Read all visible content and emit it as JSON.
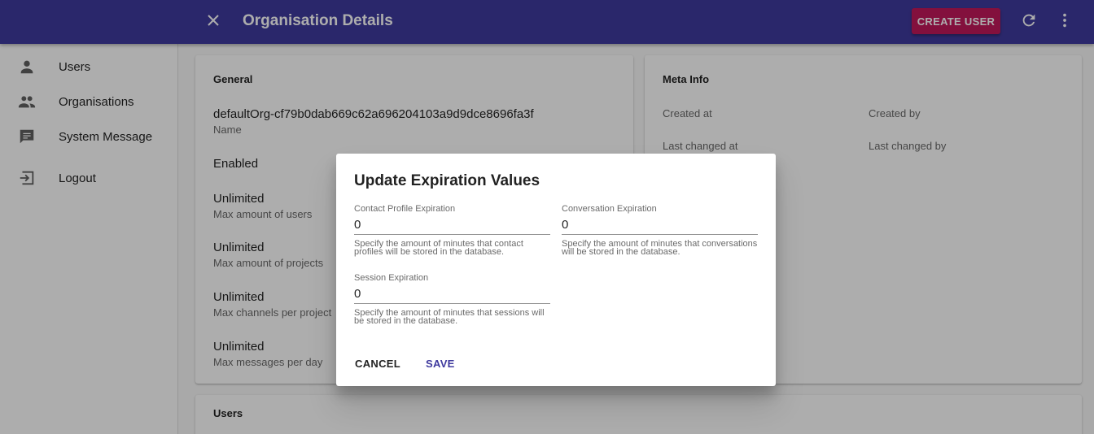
{
  "appbar": {
    "title": "Organisation Details",
    "create_user_label": "CREATE USER",
    "bg_color": "#3f3a9e",
    "accent_color": "#c2185b"
  },
  "sidebar": {
    "items": [
      {
        "label": "Users",
        "icon": "person-icon"
      },
      {
        "label": "Organisations",
        "icon": "people-icon"
      },
      {
        "label": "System Message",
        "icon": "message-icon"
      },
      {
        "label": "Logout",
        "icon": "logout-icon"
      }
    ]
  },
  "general": {
    "title": "General",
    "fields": [
      {
        "value": "defaultOrg-cf79b0dab669c62a696204103a9d9dce8696fa3f",
        "label": "Name"
      },
      {
        "value": "Enabled",
        "label": ""
      },
      {
        "value": "Unlimited",
        "label": "Max amount of users"
      },
      {
        "value": "Unlimited",
        "label": "Max amount of projects"
      },
      {
        "value": "Unlimited",
        "label": "Max channels per project"
      },
      {
        "value": "Unlimited",
        "label": "Max messages per day"
      }
    ]
  },
  "meta": {
    "title": "Meta Info",
    "created_at_label": "Created at",
    "created_by_label": "Created by",
    "last_changed_at_label": "Last changed at",
    "last_changed_by_label": "Last changed by"
  },
  "users_card": {
    "title": "Users"
  },
  "dialog": {
    "title": "Update Expiration Values",
    "contact_profile": {
      "label": "Contact Profile Expiration",
      "value": "0",
      "help": "Specify the amount of minutes that contact profiles will be stored in the database."
    },
    "conversation": {
      "label": "Conversation Expiration",
      "value": "0",
      "help": "Specify the amount of minutes that conversations will be stored in the database."
    },
    "session": {
      "label": "Session Expiration",
      "value": "0",
      "help": "Specify the amount of minutes that sessions will be stored in the database."
    },
    "cancel_label": "CANCEL",
    "save_label": "SAVE",
    "save_color": "#3f3a9e"
  }
}
